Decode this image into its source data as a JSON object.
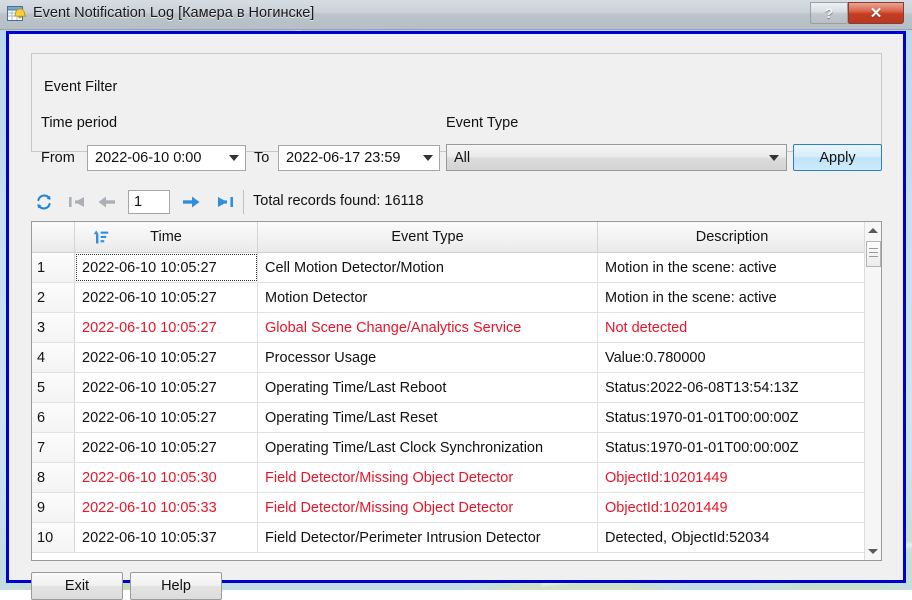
{
  "window": {
    "title": "Event Notification Log [Камера в Ногинске]",
    "icon": "event-log-icon",
    "help_button": "?",
    "close_button": "✕",
    "border_color": "#0000d2"
  },
  "filter": {
    "legend": "Event Filter",
    "time_period_label": "Time period",
    "from_label": "From",
    "from_value": "2022-06-10 0:00",
    "to_label": "To",
    "to_value": "2022-06-17 23:59",
    "event_type_label": "Event Type",
    "event_type_value": "All",
    "apply_label": "Apply"
  },
  "nav": {
    "refresh_icon": "refresh-icon",
    "first_icon": "first-page-icon",
    "prev_icon": "previous-page-icon",
    "next_icon": "next-page-icon",
    "last_icon": "last-page-icon",
    "page_value": "1",
    "total_records_label": "Total records found:",
    "total_records_value": "16118",
    "total_records_text": "Total records found:  16118"
  },
  "table": {
    "sort_icon": "sort-ascending-icon",
    "columns": [
      "",
      "Time",
      "Event Type",
      "Description"
    ],
    "alert_color": "#e8152a",
    "rows": [
      {
        "num": "1",
        "time": "2022-06-10 10:05:27",
        "type": "Cell Motion Detector/Motion",
        "desc": "Motion in the scene: active",
        "alert": false
      },
      {
        "num": "2",
        "time": "2022-06-10 10:05:27",
        "type": "Motion Detector",
        "desc": "Motion in the scene: active",
        "alert": false
      },
      {
        "num": "3",
        "time": "2022-06-10 10:05:27",
        "type": "Global Scene Change/Analytics Service",
        "desc": "Not detected",
        "alert": true
      },
      {
        "num": "4",
        "time": "2022-06-10 10:05:27",
        "type": "Processor Usage",
        "desc": "Value:0.780000",
        "alert": false
      },
      {
        "num": "5",
        "time": "2022-06-10 10:05:27",
        "type": "Operating Time/Last Reboot",
        "desc": "Status:2022-06-08T13:54:13Z",
        "alert": false
      },
      {
        "num": "6",
        "time": "2022-06-10 10:05:27",
        "type": "Operating Time/Last Reset",
        "desc": "Status:1970-01-01T00:00:00Z",
        "alert": false
      },
      {
        "num": "7",
        "time": "2022-06-10 10:05:27",
        "type": "Operating Time/Last Clock Synchronization",
        "desc": "Status:1970-01-01T00:00:00Z",
        "alert": false
      },
      {
        "num": "8",
        "time": "2022-06-10 10:05:30",
        "type": "Field Detector/Missing Object Detector",
        "desc": "ObjectId:10201449",
        "alert": true
      },
      {
        "num": "9",
        "time": "2022-06-10 10:05:33",
        "type": "Field Detector/Missing Object Detector",
        "desc": "ObjectId:10201449",
        "alert": true
      },
      {
        "num": "10",
        "time": "2022-06-10 10:05:37",
        "type": "Field Detector/Perimeter Intrusion Detector",
        "desc": "Detected, ObjectId:52034",
        "alert": false
      }
    ]
  },
  "footer": {
    "exit_label": "Exit",
    "help_label": "Help"
  }
}
